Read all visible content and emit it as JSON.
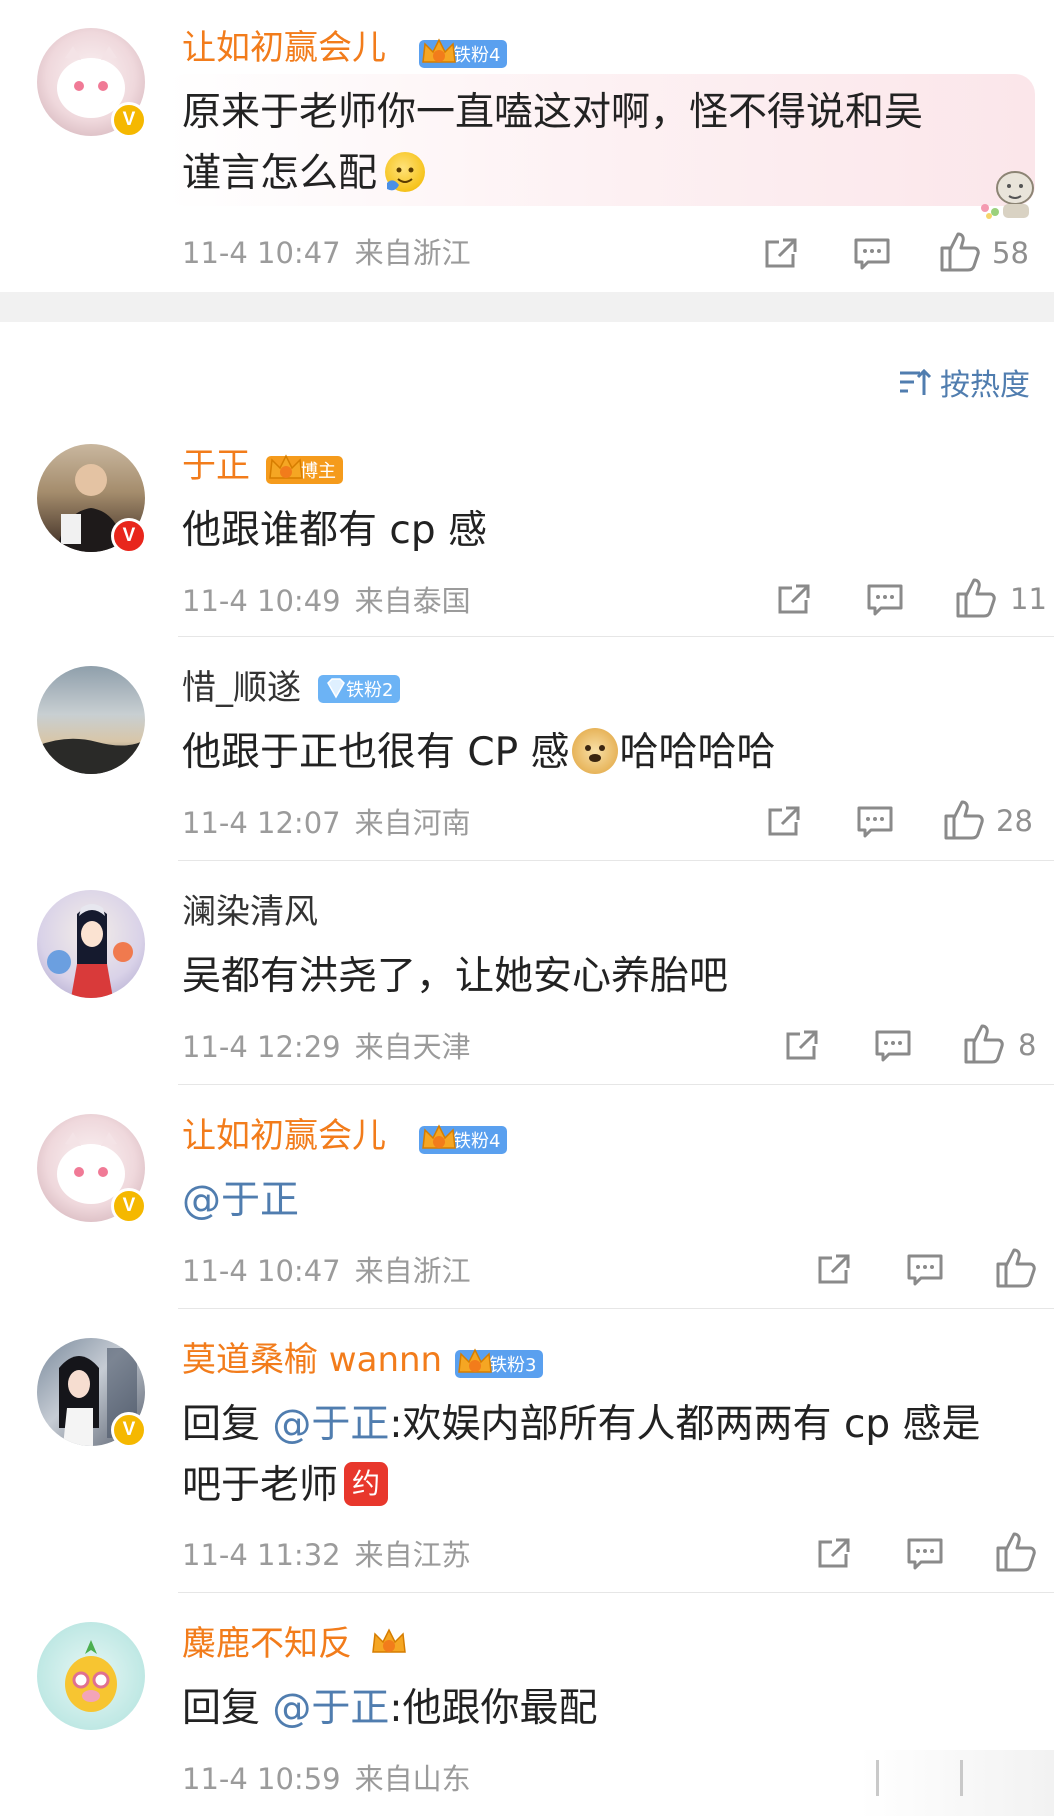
{
  "comments": [
    {
      "name": "让如初赢会儿",
      "badge": "铁粉4",
      "text_lines": [
        "原来于老师你一直嗑这对啊，怪不得说和吴",
        "谨言怎么配"
      ],
      "time": "11-4 10:47",
      "location": "来自浙江",
      "likes": "58"
    },
    {
      "name": "于正",
      "badge": "博主",
      "text": "他跟谁都有 cp 感",
      "time": "11-4 10:49",
      "location": "来自泰国",
      "likes": "11"
    },
    {
      "name": "惜_顺遂",
      "badge": "铁粉2",
      "text_before": "他跟于正也很有 CP 感",
      "text_after": "哈哈哈哈",
      "time": "11-4 12:07",
      "location": "来自河南",
      "likes": "28"
    },
    {
      "name": "澜染清风",
      "text": "吴都有洪尧了，让她安心养胎吧",
      "time": "11-4 12:29",
      "location": "来自天津",
      "likes": "8"
    },
    {
      "name": "让如初赢会儿",
      "badge": "铁粉4",
      "mention": "@于正",
      "time": "11-4 10:47",
      "location": "来自浙江"
    },
    {
      "name": "莫道桑榆 wannn",
      "badge": "铁粉3",
      "reply_prefix": "回复 ",
      "mention": "@于正",
      "text_line1": ":欢娱内部所有人都两两有 cp 感是",
      "text_line2": "吧于老师",
      "time": "11-4 11:32",
      "location": "来自江苏"
    },
    {
      "name": "麋鹿不知反",
      "reply_prefix": "回复 ",
      "mention": "@于正",
      "text": ":他跟你最配",
      "time": "11-4 10:59",
      "location": "来自山东"
    }
  ],
  "sort": {
    "label": "按热度",
    "icon": "sort-icon"
  },
  "emoji_text": {
    "stamp": "约"
  },
  "colors": {
    "orange_name": "#f27c1b",
    "mention": "#507daf",
    "meta": "#9b9b9b"
  }
}
